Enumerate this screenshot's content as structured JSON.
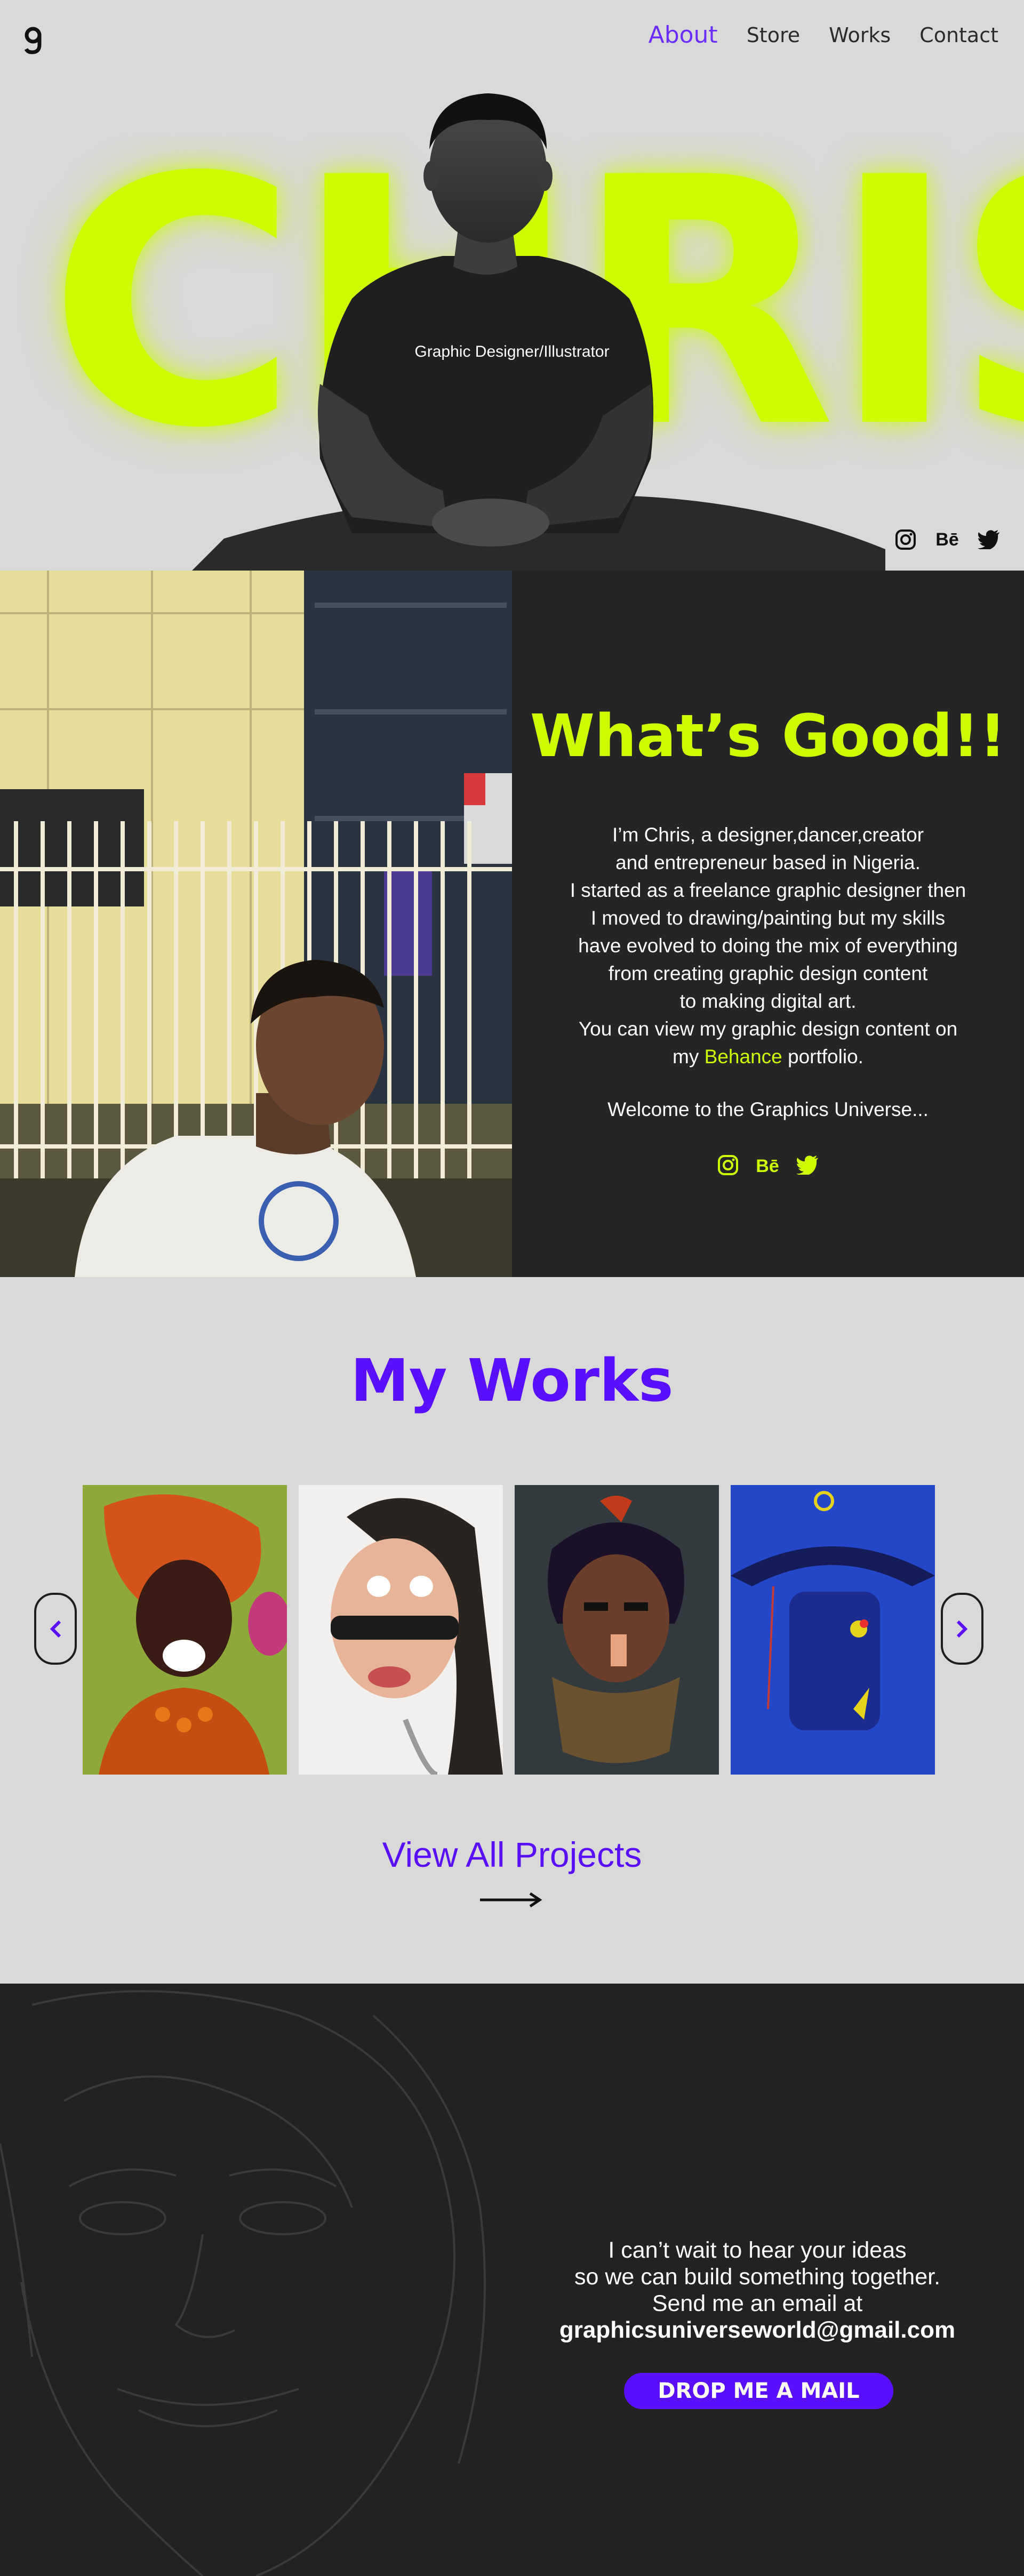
{
  "nav": {
    "logo": "g",
    "items": [
      {
        "label": "About",
        "active": true
      },
      {
        "label": "Store",
        "active": false
      },
      {
        "label": "Works",
        "active": false
      },
      {
        "label": "Contact",
        "active": false
      }
    ]
  },
  "hero": {
    "name": "CHRIS",
    "role": "Graphic Designer/Illustrator",
    "social": [
      "instagram-icon",
      "behance-icon",
      "twitter-icon"
    ],
    "behance_text": "Bē"
  },
  "about": {
    "title": "What’s Good!!",
    "lines": [
      "I’m Chris, a designer,dancer,creator",
      "and entrepreneur based in Nigeria.",
      "I started as a freelance graphic designer then",
      "I moved to drawing/painting but my skills",
      "have evolved to doing the mix of everything",
      "from creating graphic design content",
      "to making digital art.",
      "You can view my graphic design content on"
    ],
    "last_line_prefix": "my ",
    "last_line_link": "Behance",
    "last_line_suffix": " portfolio.",
    "welcome": "Welcome to the Graphics Universe...",
    "behance_text": "Bē"
  },
  "works": {
    "title": "My Works",
    "view_all": "View All Projects",
    "cards": [
      "artwork-turban-woman",
      "artwork-sunglasses-woman",
      "artwork-masked-man",
      "artwork-robot-hat"
    ]
  },
  "contact": {
    "line1": "I can’t wait to hear your ideas",
    "line2": "so we can build something together.",
    "line3": "Send me an email at",
    "email": "graphicsuniverseworld@gmail.com",
    "button": "DROP ME A MAIL"
  },
  "colors": {
    "accent_lime": "#cdfb00",
    "accent_purple": "#5a0fff",
    "dark_panel": "#252525",
    "page_bg": "#d9d9d9"
  }
}
